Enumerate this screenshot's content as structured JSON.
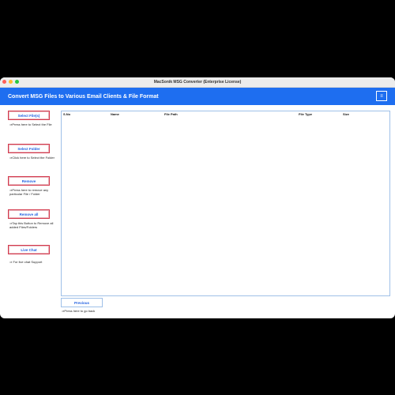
{
  "window": {
    "title": "MacSonik MSG Converter (Enterprise License)"
  },
  "header": {
    "title": "Convert MSG Files to Various Email Clients & File Format",
    "menu_icon": "hamburger-icon"
  },
  "sidebar": {
    "items": [
      {
        "label": "Select File(s)",
        "hint": "⇒Press here to Select the File"
      },
      {
        "label": "Select Folder",
        "hint": "⇒Click here to Select the Folder"
      },
      {
        "label": "Remove",
        "hint": "⇒Press here to remove any particular File / Folder"
      },
      {
        "label": "Remove all",
        "hint": "⇒Tap this Button to Remove all added Files/Folders"
      },
      {
        "label": "Live Chat",
        "hint": "⇒ For live chat Support"
      }
    ]
  },
  "table": {
    "columns": [
      "S.No",
      "Name",
      "File Path",
      "File Type",
      "Size"
    ]
  },
  "footer": {
    "previous_label": "Previous",
    "previous_hint": "⇒Press here to go back"
  },
  "colors": {
    "accent": "#1e6ef0",
    "button_border": "#d43a4e",
    "button_text": "#1e5ee0"
  }
}
